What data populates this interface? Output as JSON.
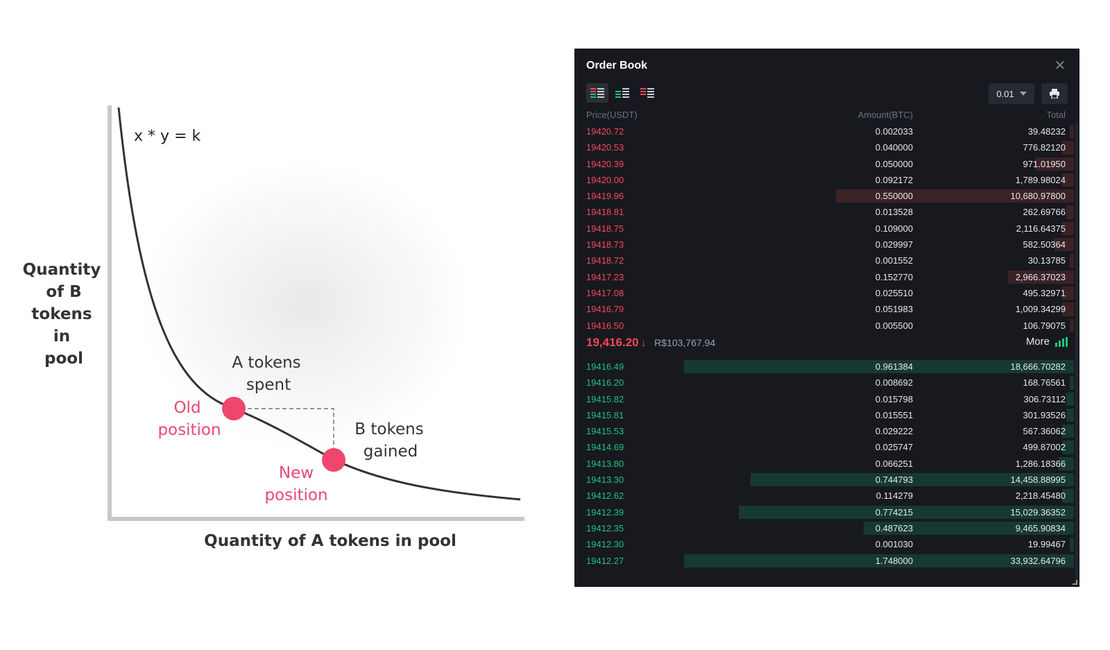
{
  "diagram": {
    "equation": "x * y = k",
    "y_axis_label_lines": [
      "Quantity",
      "of B",
      "tokens",
      "in",
      "pool"
    ],
    "x_axis_label": "Quantity of A tokens in pool",
    "a_tokens_spent_lines": [
      "A tokens",
      "spent"
    ],
    "b_tokens_gained_lines": [
      "B tokens",
      "gained"
    ],
    "old_position_lines": [
      "Old",
      "position"
    ],
    "new_position_lines": [
      "New",
      "position"
    ],
    "colors": {
      "curve": "#333333",
      "axis": "#c8c8c8",
      "point": "#f0466e",
      "text": "#333333",
      "accent_text": "#e8486e"
    }
  },
  "orderbook": {
    "title": "Order Book",
    "close_icon": "close-icon",
    "view_modes": [
      "both",
      "bids",
      "asks"
    ],
    "precision": "0.01",
    "columns": {
      "price": "Price(USDT)",
      "amount": "Amount(BTC)",
      "total": "Total"
    },
    "asks": [
      {
        "price": "19420.72",
        "amount": "0.002033",
        "total": "39.48232",
        "depth": 0.01
      },
      {
        "price": "19420.53",
        "amount": "0.040000",
        "total": "776.82120",
        "depth": 0.03
      },
      {
        "price": "19420.39",
        "amount": "0.050000",
        "total": "971.01950",
        "depth": 0.1
      },
      {
        "price": "19420.00",
        "amount": "0.092172",
        "total": "1,789.98024",
        "depth": 0.03
      },
      {
        "price": "19419.96",
        "amount": "0.550000",
        "total": "10,680.97800",
        "depth": 0.61
      },
      {
        "price": "19418.81",
        "amount": "0.013528",
        "total": "262.69766",
        "depth": 0.02
      },
      {
        "price": "19418.75",
        "amount": "0.109000",
        "total": "2,116.64375",
        "depth": 0.03
      },
      {
        "price": "19418.73",
        "amount": "0.029997",
        "total": "582.50364",
        "depth": 0.05
      },
      {
        "price": "19418.72",
        "amount": "0.001552",
        "total": "30.13785",
        "depth": 0.01
      },
      {
        "price": "19417.23",
        "amount": "0.152770",
        "total": "2,966.37023",
        "depth": 0.17
      },
      {
        "price": "19417.08",
        "amount": "0.025510",
        "total": "495.32971",
        "depth": 0.03
      },
      {
        "price": "19416.79",
        "amount": "0.051983",
        "total": "1,009.34299",
        "depth": 0.03
      },
      {
        "price": "19416.50",
        "amount": "0.005500",
        "total": "106.79075",
        "depth": 0.01
      }
    ],
    "mid_price": "19,416.20",
    "mid_direction": "↓",
    "mid_fiat": "R$103,767.94",
    "more_label": "More",
    "bids": [
      {
        "price": "19416.49",
        "amount": "0.961384",
        "total": "18,666.70282",
        "depth": 1.0
      },
      {
        "price": "19416.20",
        "amount": "0.008692",
        "total": "168.76561",
        "depth": 0.01
      },
      {
        "price": "19415.82",
        "amount": "0.015798",
        "total": "306.73112",
        "depth": 0.02
      },
      {
        "price": "19415.81",
        "amount": "0.015551",
        "total": "301.93526",
        "depth": 0.02
      },
      {
        "price": "19415.53",
        "amount": "0.029222",
        "total": "567.36062",
        "depth": 0.03
      },
      {
        "price": "19414.69",
        "amount": "0.025747",
        "total": "499.87002",
        "depth": 0.03
      },
      {
        "price": "19413.80",
        "amount": "0.066251",
        "total": "1,286.18366",
        "depth": 0.04
      },
      {
        "price": "19413.30",
        "amount": "0.744793",
        "total": "14,458.88995",
        "depth": 0.83
      },
      {
        "price": "19412.62",
        "amount": "0.114279",
        "total": "2,218.45480",
        "depth": 0.03
      },
      {
        "price": "19412.39",
        "amount": "0.774215",
        "total": "15,029.36352",
        "depth": 0.86
      },
      {
        "price": "19412.35",
        "amount": "0.487623",
        "total": "9,465.90834",
        "depth": 0.54
      },
      {
        "price": "19412.30",
        "amount": "0.001030",
        "total": "19.99467",
        "depth": 0.01
      },
      {
        "price": "19412.27",
        "amount": "1.748000",
        "total": "33,932.64796",
        "depth": 1.0
      }
    ],
    "colors": {
      "background": "#17191e",
      "ask": "#f6465d",
      "bid": "#1ec47e",
      "ask_depth": "#3a2227",
      "bid_depth": "#163a30"
    }
  }
}
